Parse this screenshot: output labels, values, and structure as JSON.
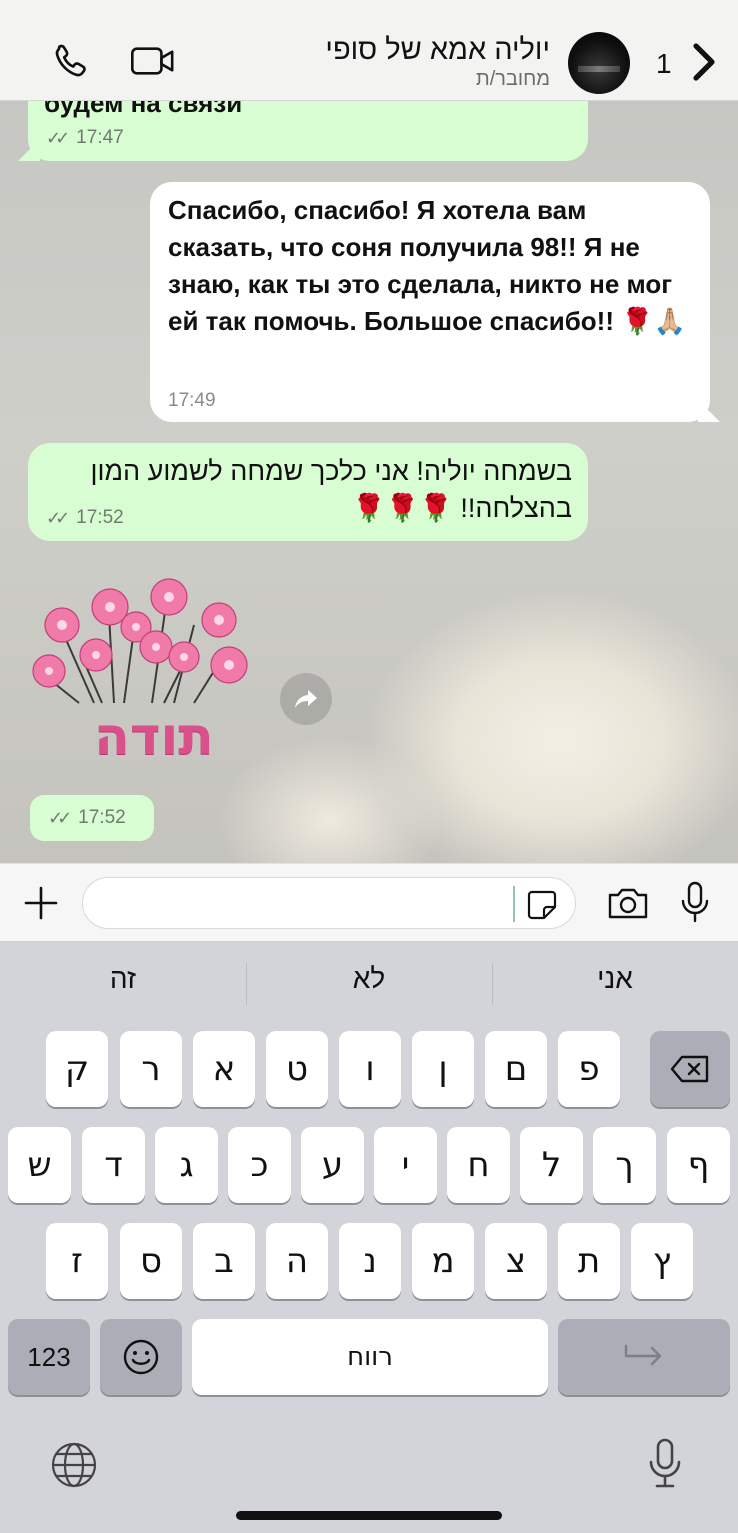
{
  "header": {
    "contact_name": "יוליה אמא של סופי",
    "status": "מחובר/ת",
    "back_count": "1",
    "icons": [
      "phone-icon",
      "video-call-icon",
      "back-chevron-icon"
    ]
  },
  "messages": [
    {
      "direction": "out",
      "text": "будем на связи",
      "time": "17:47",
      "status": "read"
    },
    {
      "direction": "in",
      "text": "Спасибо, спасибо! Я хотела вам сказать, что соня получила 98!! Я не знаю, как ты это сделала, никто не мог ей так помочь. Большое спасибо!! 🌹🙏🏼",
      "time": "17:49"
    },
    {
      "direction": "out",
      "text": "בשמחה יוליה! אני כלכך שמחה לשמוע המון בהצלחה!! 🌹🌹🌹",
      "time": "17:52",
      "status": "read"
    },
    {
      "direction": "out",
      "type": "sticker",
      "sticker_text": "תודה",
      "time": "17:52",
      "status": "read"
    }
  ],
  "input": {
    "placeholder": "",
    "icons": [
      "plus-icon",
      "sticker-icon",
      "camera-icon",
      "microphone-icon"
    ]
  },
  "keyboard": {
    "suggestions": [
      "אני",
      "לא",
      "זה"
    ],
    "row1": [
      "ק",
      "ר",
      "א",
      "ט",
      "ו",
      "ן",
      "ם",
      "פ"
    ],
    "row2": [
      "ש",
      "ד",
      "ג",
      "כ",
      "ע",
      "י",
      "ח",
      "ל",
      "ך",
      "ף"
    ],
    "row3": [
      "ז",
      "ס",
      "ב",
      "ה",
      "נ",
      "מ",
      "צ",
      "ת",
      "ץ"
    ],
    "numbers_label": "123",
    "space_label": "רווח"
  },
  "colors": {
    "outgoing_bubble": "#d9fdd3",
    "incoming_bubble": "#ffffff",
    "sticker_pink": "#d9508a"
  }
}
